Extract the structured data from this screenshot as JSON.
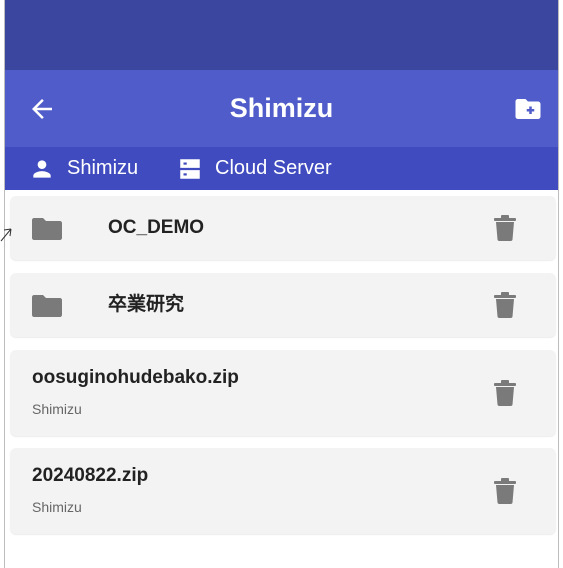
{
  "app_bar": {
    "title": "Shimizu",
    "back_icon": "arrow-left-icon",
    "new_folder_icon": "folder-plus-icon"
  },
  "breadcrumb": {
    "user": "Shimizu",
    "user_icon": "person-icon",
    "server": "Cloud Server",
    "server_icon": "server-icon"
  },
  "items": [
    {
      "type": "folder",
      "name": "OC_DEMO"
    },
    {
      "type": "folder",
      "name": "卒業研究"
    },
    {
      "type": "file",
      "name": "oosuginohudebako.zip",
      "owner": "Shimizu"
    },
    {
      "type": "file",
      "name": "20240822.zip",
      "owner": "Shimizu"
    }
  ],
  "colors": {
    "status_bar": "#3b479e",
    "app_bar": "#4f5cc9",
    "breadcrumb_bar": "#3f4bbe",
    "card_background": "#f3f3f3",
    "icon_gray": "#7a7a7a"
  }
}
